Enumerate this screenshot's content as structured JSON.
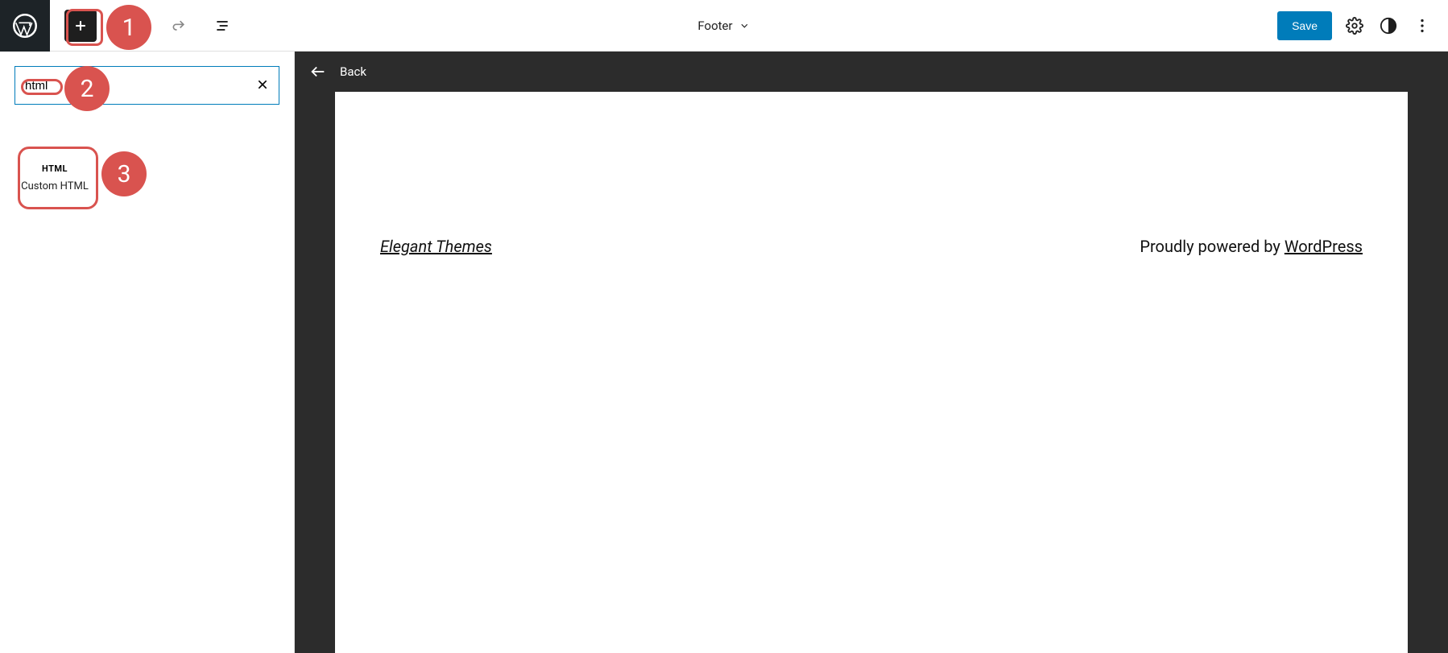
{
  "header": {
    "template_label": "Footer",
    "save_label": "Save"
  },
  "inserter": {
    "search_value": "html",
    "blocks": [
      {
        "icon_text": "HTML",
        "label": "Custom HTML"
      }
    ]
  },
  "canvas": {
    "back_label": "Back",
    "footer_left_link": "Elegant Themes",
    "footer_right_text": "Proudly powered by ",
    "footer_right_link": "WordPress"
  },
  "annotations": {
    "step1": "1",
    "step2": "2",
    "step3": "3"
  }
}
